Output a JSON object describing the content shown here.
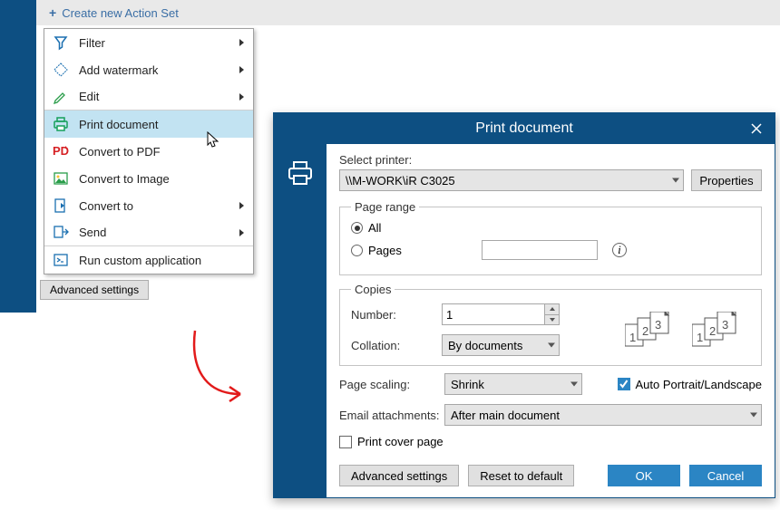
{
  "topbar": {
    "create_label": "Create new Action Set"
  },
  "advanced_peek": "Advanced settings",
  "menu": {
    "items": [
      {
        "label": "Filter",
        "icon": "filter-icon",
        "submenu": true
      },
      {
        "label": "Add watermark",
        "icon": "watermark-icon",
        "submenu": true
      },
      {
        "label": "Edit",
        "icon": "edit-icon",
        "submenu": true,
        "sep": true
      },
      {
        "label": "Print document",
        "icon": "print-icon",
        "submenu": false,
        "highlight": true
      },
      {
        "label": "Convert to PDF",
        "icon": "pdf-icon",
        "submenu": false
      },
      {
        "label": "Convert to Image",
        "icon": "image-icon",
        "submenu": false
      },
      {
        "label": "Convert to",
        "icon": "convert-icon",
        "submenu": true
      },
      {
        "label": "Send",
        "icon": "send-icon",
        "submenu": true,
        "sep": true
      },
      {
        "label": "Run custom application",
        "icon": "run-icon",
        "submenu": false
      }
    ]
  },
  "dialog": {
    "title": "Print document",
    "select_printer_label": "Select printer:",
    "printer_value": "\\\\M-WORK\\iR C3025",
    "properties_btn": "Properties",
    "page_range": {
      "legend": "Page range",
      "all": "All",
      "pages": "Pages",
      "selected": "all"
    },
    "copies": {
      "legend": "Copies",
      "number_label": "Number:",
      "number_value": "1",
      "collation_label": "Collation:",
      "collation_value": "By documents"
    },
    "page_scaling_label": "Page scaling:",
    "page_scaling_value": "Shrink",
    "auto_pl_label": "Auto Portrait/Landscape",
    "auto_pl_checked": true,
    "email_att_label": "Email attachments:",
    "email_att_value": "After main document",
    "cover_page_label": "Print cover page",
    "advanced_btn": "Advanced settings",
    "reset_btn": "Reset to default",
    "ok_btn": "OK",
    "cancel_btn": "Cancel"
  }
}
